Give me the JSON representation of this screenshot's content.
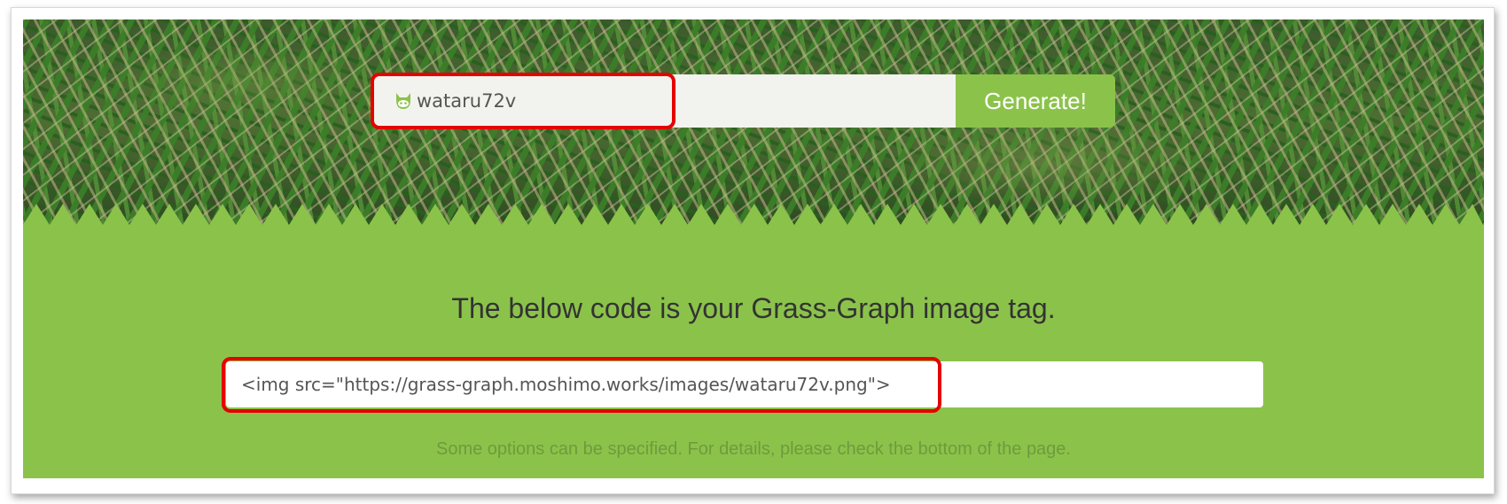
{
  "form": {
    "username_value": "wataru72v",
    "icon": "github-octocat-icon",
    "generate_label": "Generate!"
  },
  "result": {
    "headline": "The below code is your Grass-Graph image tag.",
    "code_value": "<img src=\"https://grass-graph.moshimo.works/images/wataru72v.png\">",
    "note": "Some options can be specified. For details, please check the bottom of the page."
  },
  "colors": {
    "accent_green": "#8bc34a",
    "highlight_red": "#e60000"
  }
}
